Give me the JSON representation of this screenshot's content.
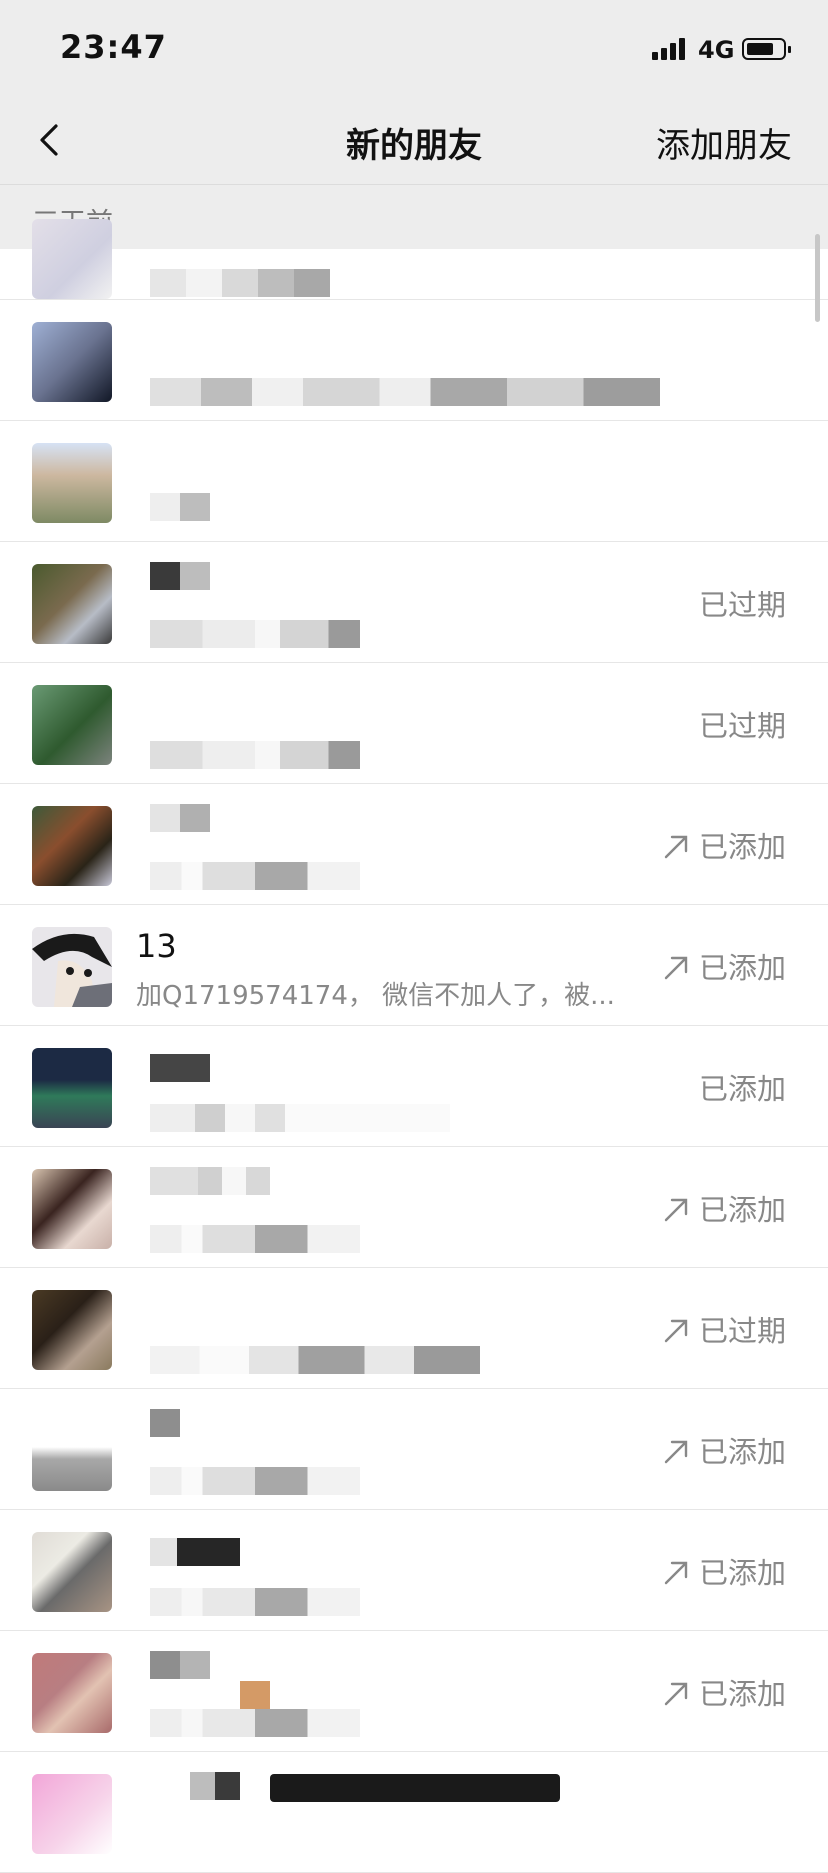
{
  "status_bar": {
    "time": "23:47",
    "network": "4G"
  },
  "nav": {
    "title": "新的朋友",
    "action": "添加朋友"
  },
  "section": {
    "label": "三天前"
  },
  "rows": [
    {
      "name": "",
      "message": "",
      "status": "",
      "arrow": false
    },
    {
      "name": "",
      "message": "",
      "status": "",
      "arrow": false
    },
    {
      "name": "",
      "message": "",
      "status": "",
      "arrow": false
    },
    {
      "name": "",
      "message": "",
      "status": "已过期",
      "arrow": false
    },
    {
      "name": "",
      "message": "",
      "status": "已过期",
      "arrow": false
    },
    {
      "name": "",
      "message": "",
      "status": "已添加",
      "arrow": true
    },
    {
      "name": "13",
      "message": "加Q1719574174， 微信不加人了，被...",
      "status": "已添加",
      "arrow": true
    },
    {
      "name": "",
      "message": "",
      "status": "已添加",
      "arrow": false
    },
    {
      "name": "",
      "message": "",
      "status": "已添加",
      "arrow": true
    },
    {
      "name": "",
      "message": "",
      "status": "已过期",
      "arrow": true
    },
    {
      "name": "",
      "message": "",
      "status": "已添加",
      "arrow": true
    },
    {
      "name": "",
      "message": "",
      "status": "已添加",
      "arrow": true
    },
    {
      "name": "",
      "message": "",
      "status": "已添加",
      "arrow": true
    },
    {
      "name": "",
      "message": "",
      "status": "",
      "arrow": false
    }
  ],
  "colors": {
    "header_bg": "#ededed",
    "secondary_text": "#888888",
    "divider": "#e6e6e6"
  }
}
